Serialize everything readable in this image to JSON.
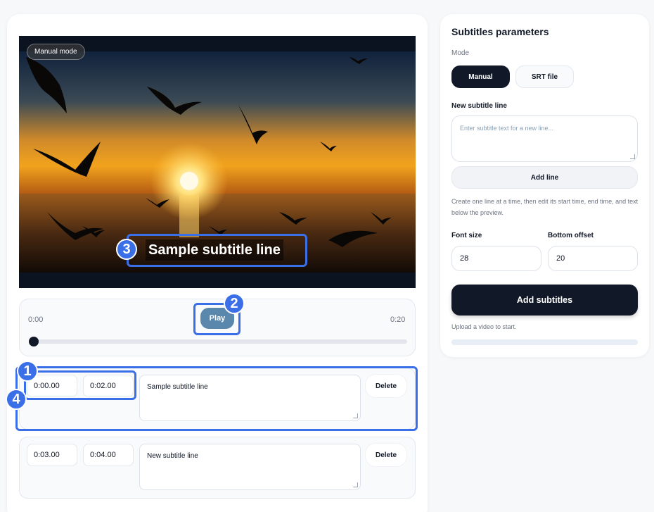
{
  "video": {
    "mode_badge": "Manual mode",
    "subtitle_preview": "Sample subtitle line"
  },
  "player": {
    "start_time": "0:00",
    "end_time": "0:20",
    "play_label": "Play",
    "position_fraction": 0
  },
  "subtitle_rows": [
    {
      "start": "0:00.00",
      "end": "0:02.00",
      "text": "Sample subtitle line",
      "delete_label": "Delete"
    },
    {
      "start": "0:03.00",
      "end": "0:04.00",
      "text": "New subtitle line",
      "delete_label": "Delete"
    }
  ],
  "annotations": [
    "1",
    "2",
    "3",
    "4"
  ],
  "panel": {
    "title": "Subtitles parameters",
    "mode_label": "Mode",
    "mode_options": [
      "Manual",
      "SRT file"
    ],
    "selected_mode": "Manual",
    "new_line_label": "New subtitle line",
    "new_line_placeholder": "Enter subtitle text for a new line...",
    "add_line_label": "Add line",
    "help_text": "Create one line at a time, then edit its start time, end time, and text below the preview.",
    "font_size_label": "Font size",
    "font_size_value": "28",
    "bottom_offset_label": "Bottom offset",
    "bottom_offset_value": "20",
    "add_subtitles_label": "Add subtitles",
    "status_text": "Upload a video to start.",
    "progress_fraction": 0
  },
  "colors": {
    "accent": "#3b6fe8",
    "primary_dark": "#111827",
    "play_button": "#5a88ad"
  }
}
